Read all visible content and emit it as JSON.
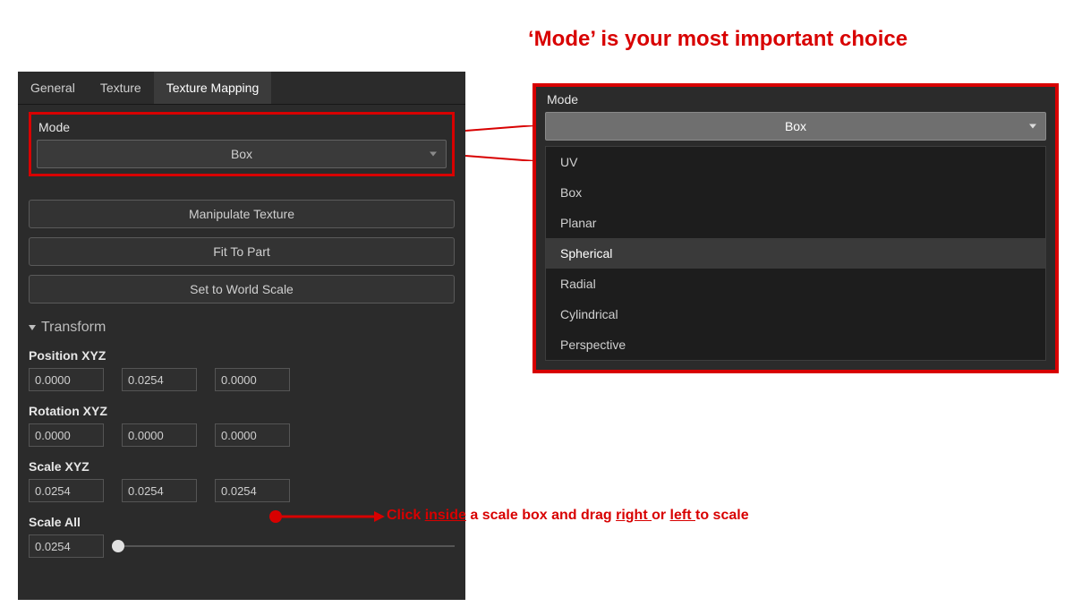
{
  "annotations": {
    "title": "‘Mode’ is your most important choice",
    "scale_prefix": "Click ",
    "scale_w1": "inside",
    "scale_mid": " a scale box and drag ",
    "scale_w2": "right ",
    "scale_or": "or ",
    "scale_w3": "left ",
    "scale_suffix": "to scale"
  },
  "tabs": {
    "general": "General",
    "texture": "Texture",
    "texture_mapping": "Texture Mapping"
  },
  "mode": {
    "label": "Mode",
    "selected": "Box"
  },
  "buttons": {
    "manipulate": "Manipulate Texture",
    "fit": "Fit To Part",
    "world": "Set to World Scale"
  },
  "transform": {
    "header": "Transform",
    "position_label": "Position XYZ",
    "position": [
      "0.0000",
      "0.0254",
      "0.0000"
    ],
    "rotation_label": "Rotation XYZ",
    "rotation": [
      "0.0000",
      "0.0000",
      "0.0000"
    ],
    "scale_label": "Scale XYZ",
    "scale": [
      "0.0254",
      "0.0254",
      "0.0254"
    ],
    "scale_all_label": "Scale All",
    "scale_all": "0.0254"
  },
  "dropdown": {
    "open_value": "Box",
    "options": [
      "UV",
      "Box",
      "Planar",
      "Spherical",
      "Radial",
      "Cylindrical",
      "Perspective"
    ],
    "hover_index": 3
  }
}
